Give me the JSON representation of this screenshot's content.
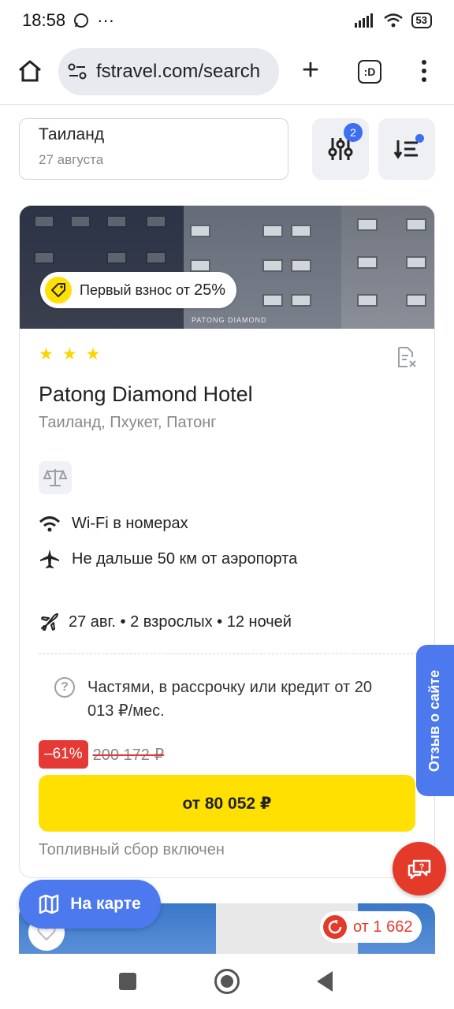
{
  "status_bar": {
    "time": "18:58",
    "more": "···",
    "battery": "53"
  },
  "browser": {
    "url": "fstravel.com/search",
    "tabs_label": ":D"
  },
  "search": {
    "destination": "Таиланд",
    "date": "27 августа"
  },
  "filters": {
    "badge_count": "2"
  },
  "hotel_card": {
    "promo": "Первый взнос от",
    "promo_percent": "25%",
    "stars": 3,
    "name": "Patong Diamond Hotel",
    "location": "Таиланд, Пхукет, Патонг",
    "features": [
      {
        "icon": "wifi-icon",
        "label": "Wi-Fi в номерах"
      },
      {
        "icon": "airplane-icon",
        "label": "Не дальше 50 км от аэропорта"
      }
    ],
    "trip_info": "27 авг. • 2 взрослых • 12 ночей",
    "installment": "Частями, в рассрочку или кредит от 20 013 ₽/мес.",
    "discount": "–61%",
    "old_price": "200 172 ₽",
    "price_button": "от 80 052 ₽",
    "fuel_note": "Топливный сбор включен",
    "building_sign": "PATONG DIAMOND"
  },
  "feedback_tab": "Отзыв о сайте",
  "map_button": "На карте",
  "next_card": {
    "price_chip": "от 1 662"
  },
  "colors": {
    "accent_blue": "#4c79ee",
    "price_yellow": "#ffe000",
    "discount_red": "#e53935",
    "star_yellow": "#ffd400"
  }
}
